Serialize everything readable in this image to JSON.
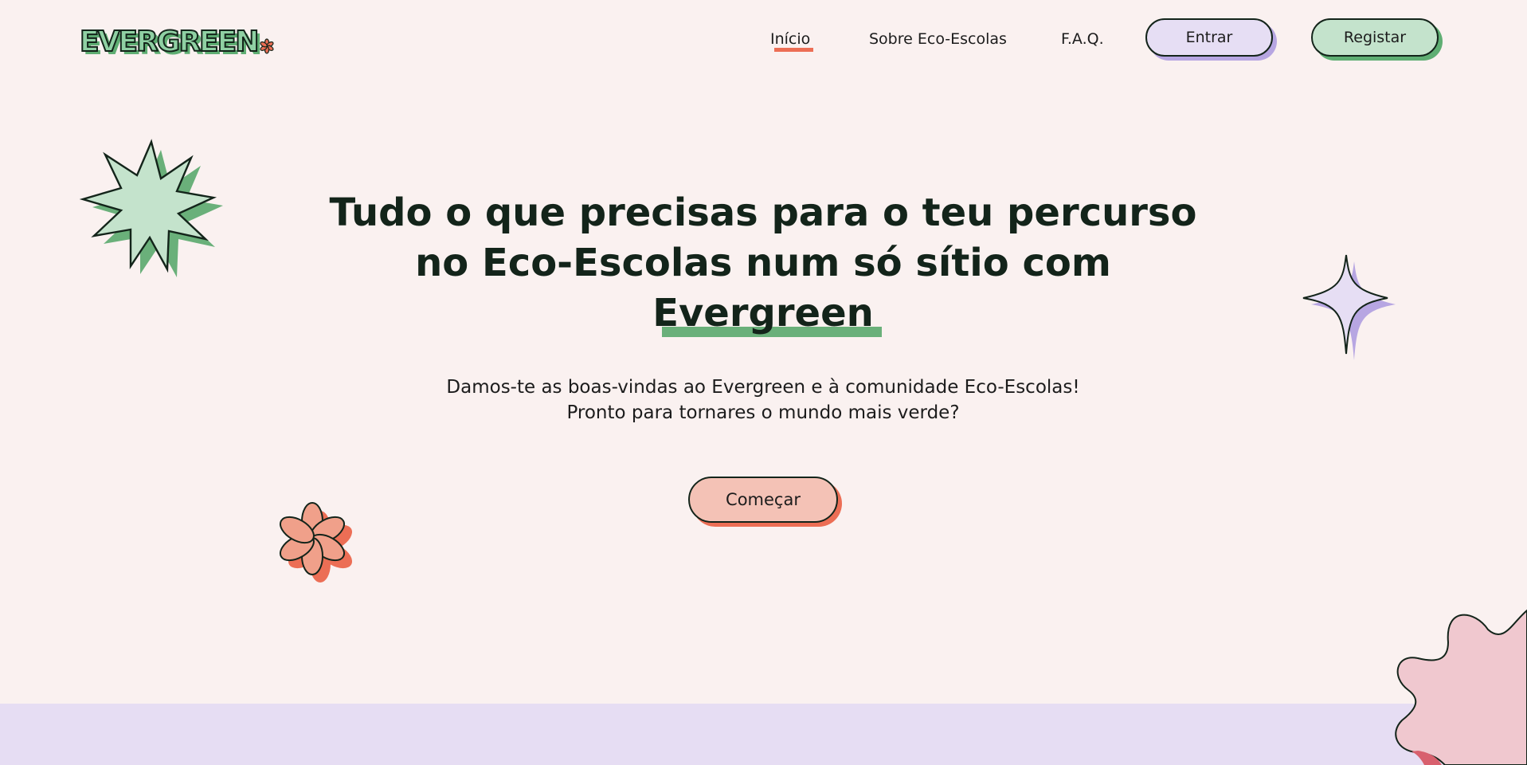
{
  "brand": {
    "logo_text": "EVERGREEN",
    "colors": {
      "background": "#faf1f0",
      "green": "#6ab07a",
      "green_light": "#c4e3cc",
      "lavender": "#e6def4",
      "lavender_dark": "#b7a6e2",
      "coral": "#ec6e55",
      "coral_light": "#f4c2b6",
      "pink": "#f0c8cf",
      "text": "#13241a"
    }
  },
  "nav": {
    "links": [
      {
        "label": "Início",
        "active": true
      },
      {
        "label": "Sobre Eco-Escolas",
        "active": false
      },
      {
        "label": "F.A.Q.",
        "active": false
      }
    ],
    "login_label": "Entrar",
    "register_label": "Registar"
  },
  "hero": {
    "title_line1": "Tudo o que precisas para o teu percurso",
    "title_line2": "no Eco-Escolas num só sítio com",
    "title_highlight": "Evergreen",
    "subtitle_line1": "Damos-te as boas-vindas ao Evergreen e à comunidade Eco-Escolas!",
    "subtitle_line2": "Pronto para tornares o mundo mais verde?",
    "cta_label": "Começar"
  },
  "decorations": {
    "icons": [
      "starburst-icon",
      "sparkle-star-icon",
      "flower-icon",
      "wavy-blob-icon"
    ]
  }
}
